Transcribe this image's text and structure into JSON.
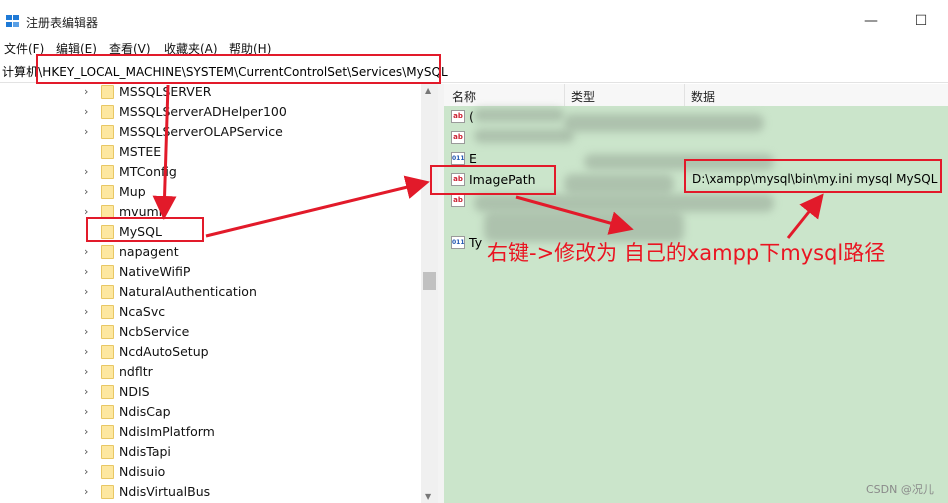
{
  "window": {
    "title": "注册表编辑器",
    "minimize_glyph": "—",
    "maximize_glyph": "☐"
  },
  "menu": {
    "items": [
      "文件(F)",
      "编辑(E)",
      "查看(V)",
      "收藏夹(A)",
      "帮助(H)"
    ]
  },
  "address": {
    "path": "计算机\\HKEY_LOCAL_MACHINE\\SYSTEM\\CurrentControlSet\\Services\\MySQL"
  },
  "tree": {
    "items": [
      {
        "label": "MSSQLSERVER",
        "expandable": true
      },
      {
        "label": "MSSQLServerADHelper100",
        "expandable": true
      },
      {
        "label": "MSSQLServerOLAPService",
        "expandable": true
      },
      {
        "label": "MSTEE",
        "expandable": false
      },
      {
        "label": "MTConfig",
        "expandable": true
      },
      {
        "label": "Mup",
        "expandable": true
      },
      {
        "label": "mvumi",
        "expandable": true
      },
      {
        "label": "MySQL",
        "expandable": false,
        "selected": true
      },
      {
        "label": "napagent",
        "expandable": true
      },
      {
        "label": "NativeWifiP",
        "expandable": true
      },
      {
        "label": "NaturalAuthentication",
        "expandable": true
      },
      {
        "label": "NcaSvc",
        "expandable": true
      },
      {
        "label": "NcbService",
        "expandable": true
      },
      {
        "label": "NcdAutoSetup",
        "expandable": true
      },
      {
        "label": "ndfltr",
        "expandable": true
      },
      {
        "label": "NDIS",
        "expandable": true
      },
      {
        "label": "NdisCap",
        "expandable": true
      },
      {
        "label": "NdisImPlatform",
        "expandable": true
      },
      {
        "label": "NdisTapi",
        "expandable": true
      },
      {
        "label": "Ndisuio",
        "expandable": true
      },
      {
        "label": "NdisVirtualBus",
        "expandable": true
      }
    ]
  },
  "values_pane": {
    "columns": {
      "name": "名称",
      "type": "类型",
      "data": "数据"
    },
    "rows": [
      {
        "icon": "ab",
        "name": "(",
        "data": ""
      },
      {
        "icon": "ab",
        "name": "",
        "data": ""
      },
      {
        "icon": "bin",
        "name": "E",
        "data": ""
      },
      {
        "icon": "ab",
        "name": "ImagePath",
        "data": "D:\\xampp\\mysql\\bin\\my.ini mysql MySQL"
      },
      {
        "icon": "ab",
        "name": "",
        "data": ""
      },
      {
        "icon": "bin",
        "name": "Ty",
        "data": ""
      }
    ]
  },
  "annotation": {
    "text": "右键->修改为 自己的xampp下mysql路径",
    "color": "#ea1421"
  },
  "watermark": "CSDN @况儿",
  "colors": {
    "values_bg": "#cbe5cb",
    "highlight_red": "#e21a2a",
    "folder": "#fde7a0"
  }
}
